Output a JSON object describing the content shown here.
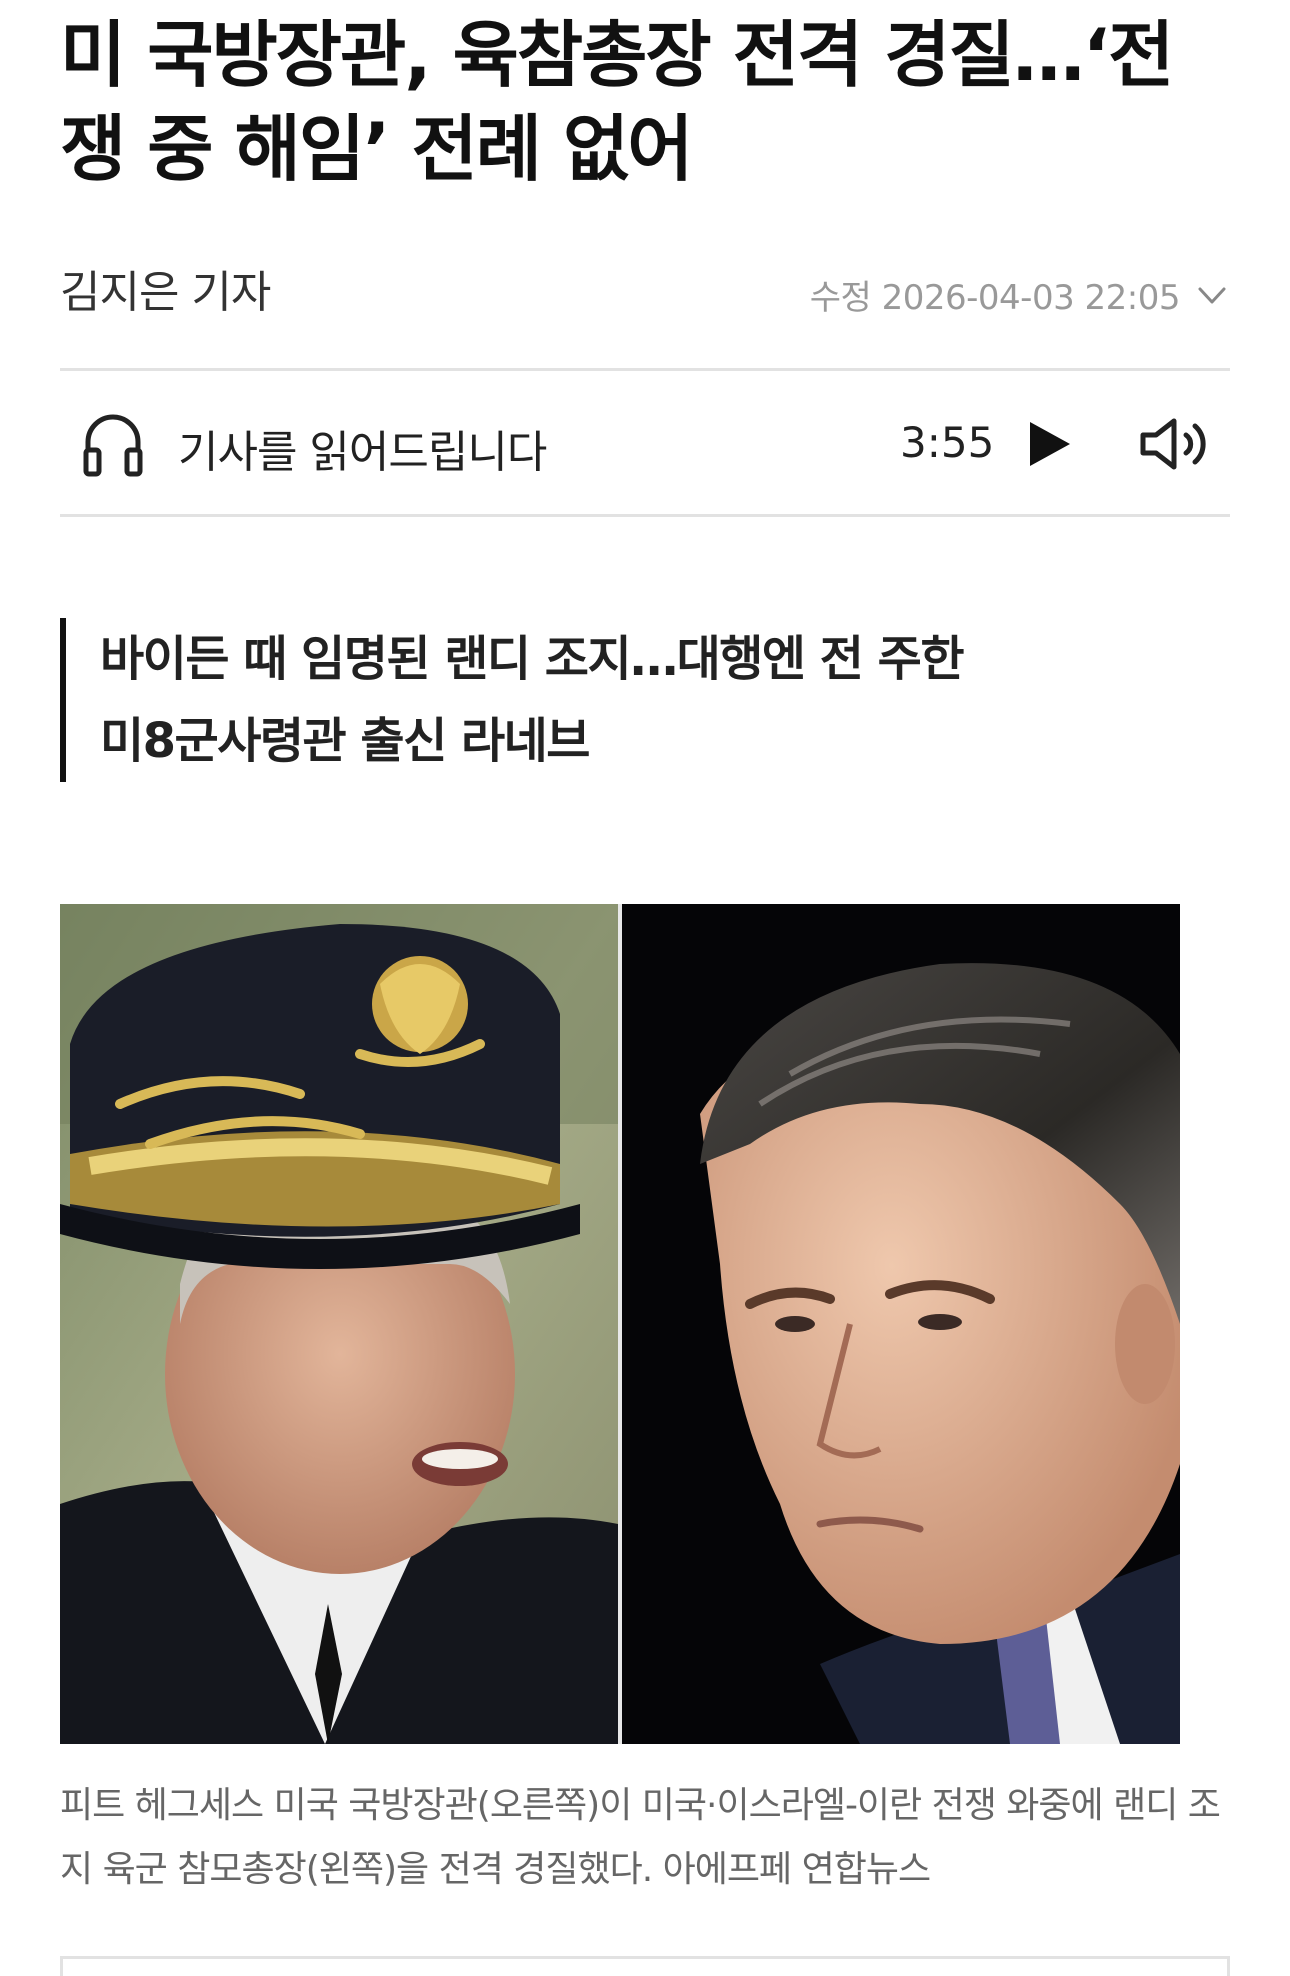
{
  "article": {
    "headline": "미 국방장관, 육참총장 전격 경질…‘전쟁 중 해임’ 전례 없어",
    "author": "김지은 기자",
    "date_label": "수정 2026-04-03 22:05",
    "subheadline_line1": "바이든 때 임명된 랜디 조지…대행엔 전 주한",
    "subheadline_line2": "미8군사령관 출신 라네브",
    "photo_caption": "피트 헤그세스 미국 국방장관(오른쪽)이 미국·이스라엘-이란 전쟁 와중에 랜디 조지 육군 참모총장(왼쪽)을 전격 경질했다. 아에프페 연합뉴스"
  },
  "audio_player": {
    "label": "기사를 읽어드립니다",
    "duration": "3:55",
    "icons": {
      "headphones": "headphones-icon",
      "play": "play-icon",
      "volume": "volume-icon",
      "chevron": "chevron-down-icon"
    }
  },
  "colors": {
    "text": "#111111",
    "muted": "#999999",
    "caption": "#666666",
    "divider": "#e2e2e2"
  }
}
